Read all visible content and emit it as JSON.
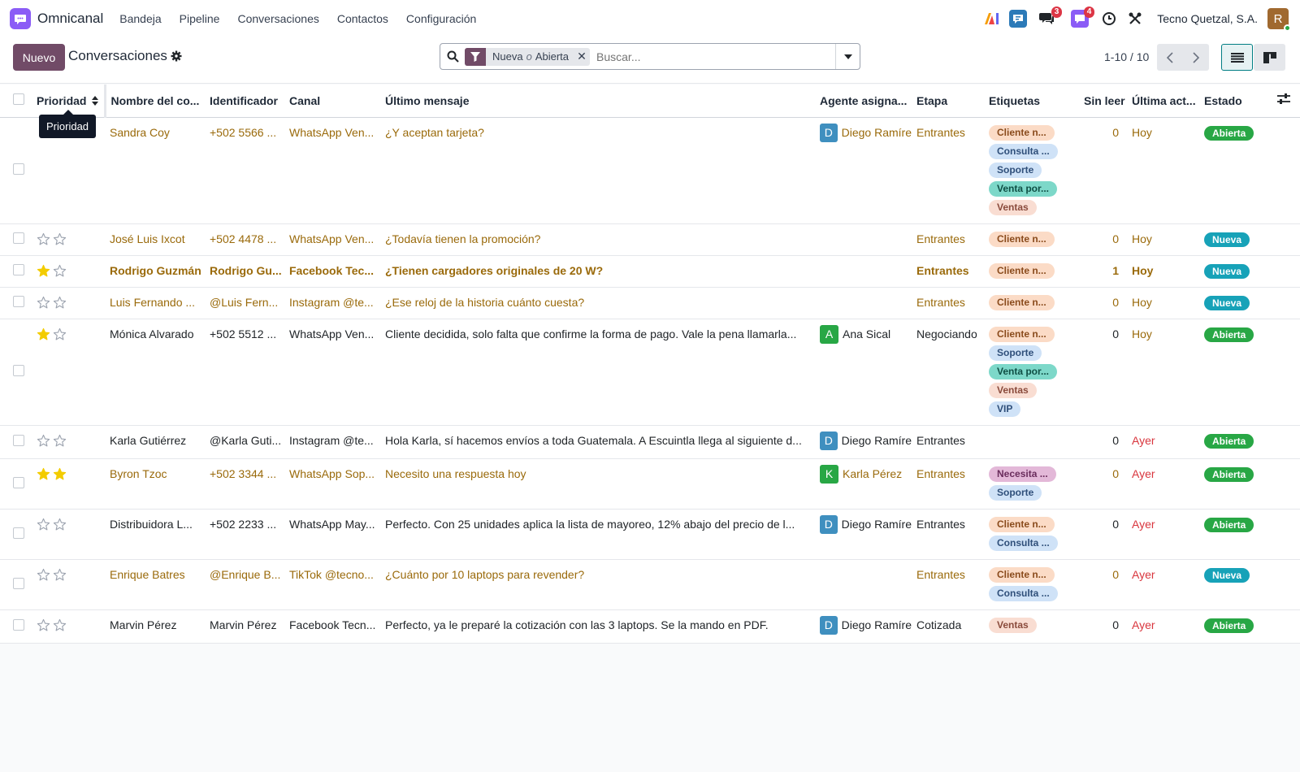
{
  "navbar": {
    "app_name": "Omnicanal",
    "menu": [
      "Bandeja",
      "Pipeline",
      "Conversaciones",
      "Contactos",
      "Configuración"
    ],
    "chat_badge": "3",
    "activity_badge": "4",
    "company": "Tecno Quetzal, S.A.",
    "avatar_initial": "R"
  },
  "control": {
    "new_label": "Nuevo",
    "title": "Conversaciones",
    "facet_values": [
      "Nueva",
      "Abierta"
    ],
    "facet_separator": "o",
    "search_placeholder": "Buscar...",
    "pager": "1-10 / 10"
  },
  "table": {
    "headers": {
      "priority": "Prioridad",
      "name": "Nombre del co...",
      "identifier": "Identificador",
      "channel": "Canal",
      "last_message": "Último mensaje",
      "agent": "Agente asigna...",
      "stage": "Etapa",
      "tags": "Etiquetas",
      "unread": "Sin leer",
      "last_activity": "Última act...",
      "status": "Estado"
    },
    "tooltip": "Prioridad",
    "rows": [
      {
        "stars": 0,
        "show_stars": false,
        "name": "Sandra Coy",
        "identifier": "+502 5566 ...",
        "channel": "WhatsApp Ven...",
        "message": "¿Y aceptan tarjeta?",
        "agent": {
          "initial": "D",
          "name": "Diego Ramíre",
          "color": "#3f8fbf"
        },
        "stage": "Entrantes",
        "tags": [
          "Cliente n...",
          "Consulta ...",
          "Soporte",
          "Venta por...",
          "Ventas"
        ],
        "unread": "0",
        "activity": "Hoy",
        "status": "Abierta",
        "tone": "gold",
        "bold": false
      },
      {
        "stars": 0,
        "show_stars": true,
        "name": "José Luis Ixcot",
        "identifier": "+502 4478 ...",
        "channel": "WhatsApp Ven...",
        "message": "¿Todavía tienen la promoción?",
        "agent": null,
        "stage": "Entrantes",
        "tags": [
          "Cliente n..."
        ],
        "unread": "0",
        "activity": "Hoy",
        "status": "Nueva",
        "tone": "gold",
        "bold": false
      },
      {
        "stars": 1,
        "show_stars": true,
        "name": "Rodrigo Guzmán",
        "identifier": "Rodrigo Gu...",
        "channel": "Facebook Tec...",
        "message": "¿Tienen cargadores originales de 20 W?",
        "agent": null,
        "stage": "Entrantes",
        "tags": [
          "Cliente n..."
        ],
        "unread": "1",
        "activity": "Hoy",
        "status": "Nueva",
        "tone": "gold",
        "bold": true
      },
      {
        "stars": 0,
        "show_stars": true,
        "name": "Luis Fernando ...",
        "identifier": "@Luis Fern...",
        "channel": "Instagram @te...",
        "message": "¿Ese reloj de la historia cuánto cuesta?",
        "agent": null,
        "stage": "Entrantes",
        "tags": [
          "Cliente n..."
        ],
        "unread": "0",
        "activity": "Hoy",
        "status": "Nueva",
        "tone": "gold",
        "bold": false
      },
      {
        "stars": 1,
        "show_stars": true,
        "name": "Mónica Alvarado",
        "identifier": "+502 5512 ...",
        "channel": "WhatsApp Ven...",
        "message": "Cliente decidida, solo falta que confirme la forma de pago. Vale la pena llamarla...",
        "agent": {
          "initial": "A",
          "name": "Ana Sical",
          "color": "#28a745"
        },
        "stage": "Negociando",
        "tags": [
          "Cliente n...",
          "Soporte",
          "Venta por...",
          "Ventas",
          "VIP"
        ],
        "unread": "0",
        "activity": "Hoy",
        "status": "Abierta",
        "tone": "dark",
        "bold": false
      },
      {
        "stars": 0,
        "show_stars": true,
        "name": "Karla Gutiérrez",
        "identifier": "@Karla Guti...",
        "channel": "Instagram @te...",
        "message": "Hola Karla, sí hacemos envíos a toda Guatemala. A Escuintla llega al siguiente d...",
        "agent": {
          "initial": "D",
          "name": "Diego Ramíre",
          "color": "#3f8fbf"
        },
        "stage": "Entrantes",
        "tags": [],
        "unread": "0",
        "activity": "Ayer",
        "status": "Abierta",
        "tone": "dark",
        "bold": false
      },
      {
        "stars": 2,
        "show_stars": true,
        "name": "Byron Tzoc",
        "identifier": "+502 3344 ...",
        "channel": "WhatsApp Sop...",
        "message": "Necesito una respuesta hoy",
        "agent": {
          "initial": "K",
          "name": "Karla Pérez",
          "color": "#28a745"
        },
        "stage": "Entrantes",
        "tags": [
          "Necesita ...",
          "Soporte"
        ],
        "unread": "0",
        "activity": "Ayer",
        "status": "Abierta",
        "tone": "gold",
        "bold": false
      },
      {
        "stars": 0,
        "show_stars": true,
        "name": "Distribuidora L...",
        "identifier": "+502 2233 ...",
        "channel": "WhatsApp May...",
        "message": "Perfecto. Con 25 unidades aplica la lista de mayoreo, 12% abajo del precio de l...",
        "agent": {
          "initial": "D",
          "name": "Diego Ramíre",
          "color": "#3f8fbf"
        },
        "stage": "Entrantes",
        "tags": [
          "Cliente n...",
          "Consulta ..."
        ],
        "unread": "0",
        "activity": "Ayer",
        "status": "Abierta",
        "tone": "dark",
        "bold": false
      },
      {
        "stars": 0,
        "show_stars": true,
        "name": "Enrique Batres",
        "identifier": "@Enrique B...",
        "channel": "TikTok @tecno...",
        "message": "¿Cuánto por 10 laptops para revender?",
        "agent": null,
        "stage": "Entrantes",
        "tags": [
          "Cliente n...",
          "Consulta ..."
        ],
        "unread": "0",
        "activity": "Ayer",
        "status": "Nueva",
        "tone": "gold",
        "bold": false
      },
      {
        "stars": 0,
        "show_stars": true,
        "name": "Marvin Pérez",
        "identifier": "Marvin Pérez",
        "channel": "Facebook Tecn...",
        "message": "Perfecto, ya le preparé la cotización con las 3 laptops. Se la mando en PDF.",
        "agent": {
          "initial": "D",
          "name": "Diego Ramíre",
          "color": "#3f8fbf"
        },
        "stage": "Cotizada",
        "tags": [
          "Ventas"
        ],
        "unread": "0",
        "activity": "Ayer",
        "status": "Abierta",
        "tone": "dark",
        "bold": false
      }
    ]
  },
  "colors": {
    "brand": "#714b67",
    "star": "#f3cc00",
    "status_open": "#28a745",
    "status_new": "#17a2b8",
    "tag_colors": {
      "Cliente n...": [
        "#fbdbc6",
        "#8a4b1c"
      ],
      "Consulta ...": [
        "#cfe2f7",
        "#2f4f7a"
      ],
      "Soporte": [
        "#cfe2f7",
        "#2f4f7a"
      ],
      "Venta por...": [
        "#7dd8c9",
        "#0f4f45"
      ],
      "Ventas": [
        "#f9ddd2",
        "#8a4b3c"
      ],
      "VIP": [
        "#cfe2f7",
        "#2f4f7a"
      ],
      "Necesita ...": [
        "#e3b8d8",
        "#6a2c5c"
      ]
    }
  }
}
